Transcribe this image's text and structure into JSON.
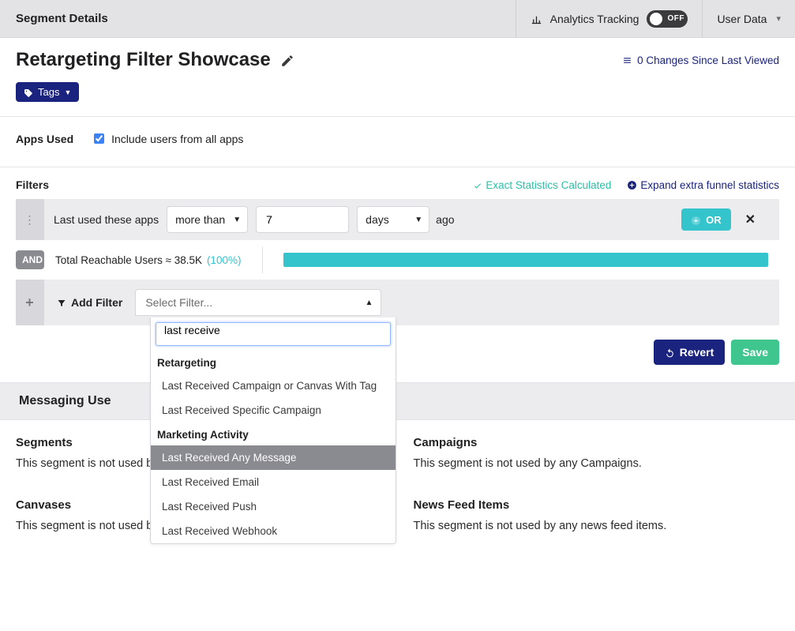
{
  "topbar": {
    "title": "Segment Details",
    "analytics_label": "Analytics Tracking",
    "analytics_state": "OFF",
    "userdata_label": "User Data"
  },
  "header": {
    "page_title": "Retargeting Filter Showcase",
    "changes_link": "0 Changes Since Last Viewed",
    "tags_label": "Tags"
  },
  "apps_used": {
    "label": "Apps Used",
    "checkbox_label": "Include users from all apps"
  },
  "filters": {
    "title": "Filters",
    "stat_ok": "Exact Statistics Calculated",
    "stat_expand": "Expand extra funnel statistics",
    "row1": {
      "label": "Last used these apps",
      "comparator": "more than",
      "value": "7",
      "unit": "days",
      "suffix": "ago",
      "or_label": "OR"
    },
    "and": {
      "badge": "AND",
      "stats_text": "Total Reachable Users ≈ 38.5K",
      "pct": "(100%)"
    },
    "addfilter": {
      "label": "Add Filter",
      "placeholder": "Select Filter...",
      "search_value": "last receive",
      "groups": [
        {
          "name": "Retargeting",
          "options": [
            "Last Received Campaign or Canvas With Tag",
            "Last Received Specific Campaign"
          ]
        },
        {
          "name": "Marketing Activity",
          "options": [
            "Last Received Any Message",
            "Last Received Email",
            "Last Received Push",
            "Last Received Webhook"
          ],
          "selected_index": 0
        }
      ]
    }
  },
  "actions": {
    "revert": "Revert",
    "save": "Save"
  },
  "messaging": {
    "title": "Messaging Use",
    "cells": {
      "segments": {
        "h": "Segments",
        "p": "This segment is not used by any Segments."
      },
      "campaigns": {
        "h": "Campaigns",
        "p": "This segment is not used by any Campaigns."
      },
      "canvases": {
        "h": "Canvases",
        "p": "This segment is not used by any Canvases."
      },
      "newsfeed": {
        "h": "News Feed Items",
        "p": "This segment is not used by any news feed items."
      }
    }
  }
}
